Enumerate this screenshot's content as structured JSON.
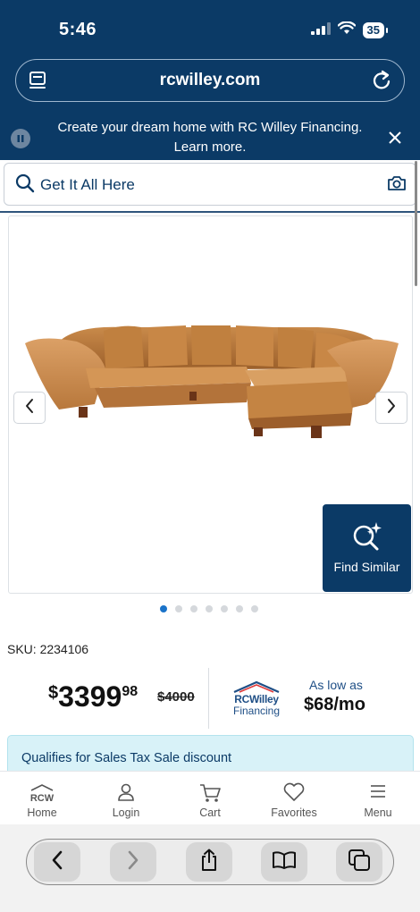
{
  "status_bar": {
    "time": "5:46",
    "battery": "35"
  },
  "browser": {
    "url": "rcwilley.com"
  },
  "promo": {
    "text": "Create your dream home with RC Willey Financing. Learn more."
  },
  "search": {
    "placeholder": "Get It All Here"
  },
  "product": {
    "image_alt": "Sectional sofa",
    "find_similar_label": "Find Similar",
    "carousel_total": 7,
    "carousel_active": 1,
    "sku_label": "SKU:",
    "sku_value": "2234106"
  },
  "price": {
    "dollar_sign": "$",
    "whole": "3399",
    "cents": "98",
    "original": "$4000"
  },
  "financing": {
    "logo_name": "RCWilley",
    "logo_sub": "Financing",
    "as_low_as": "As low as",
    "monthly": "$68/mo"
  },
  "tax_banner": {
    "text": "Qualifies for Sales Tax Sale discount"
  },
  "bottom_nav": {
    "home": "Home",
    "home_logo": "RCW",
    "login": "Login",
    "cart": "Cart",
    "favorites": "Favorites",
    "menu": "Menu"
  },
  "colors": {
    "brand_navy": "#0b3a66",
    "dot_active": "#1a73c9",
    "tax_banner_bg": "#d8f2f8"
  },
  "icons": [
    "signal-icon",
    "wifi-icon",
    "battery-icon",
    "tabs-icon",
    "reload-icon",
    "pause-icon",
    "close-icon",
    "search-icon",
    "camera-icon",
    "chevron-left-icon",
    "chevron-right-icon",
    "sparkle-search-icon",
    "user-icon",
    "cart-icon",
    "heart-icon",
    "menu-icon",
    "back-icon",
    "forward-icon",
    "share-icon",
    "bookmarks-icon",
    "tab-switcher-icon"
  ]
}
